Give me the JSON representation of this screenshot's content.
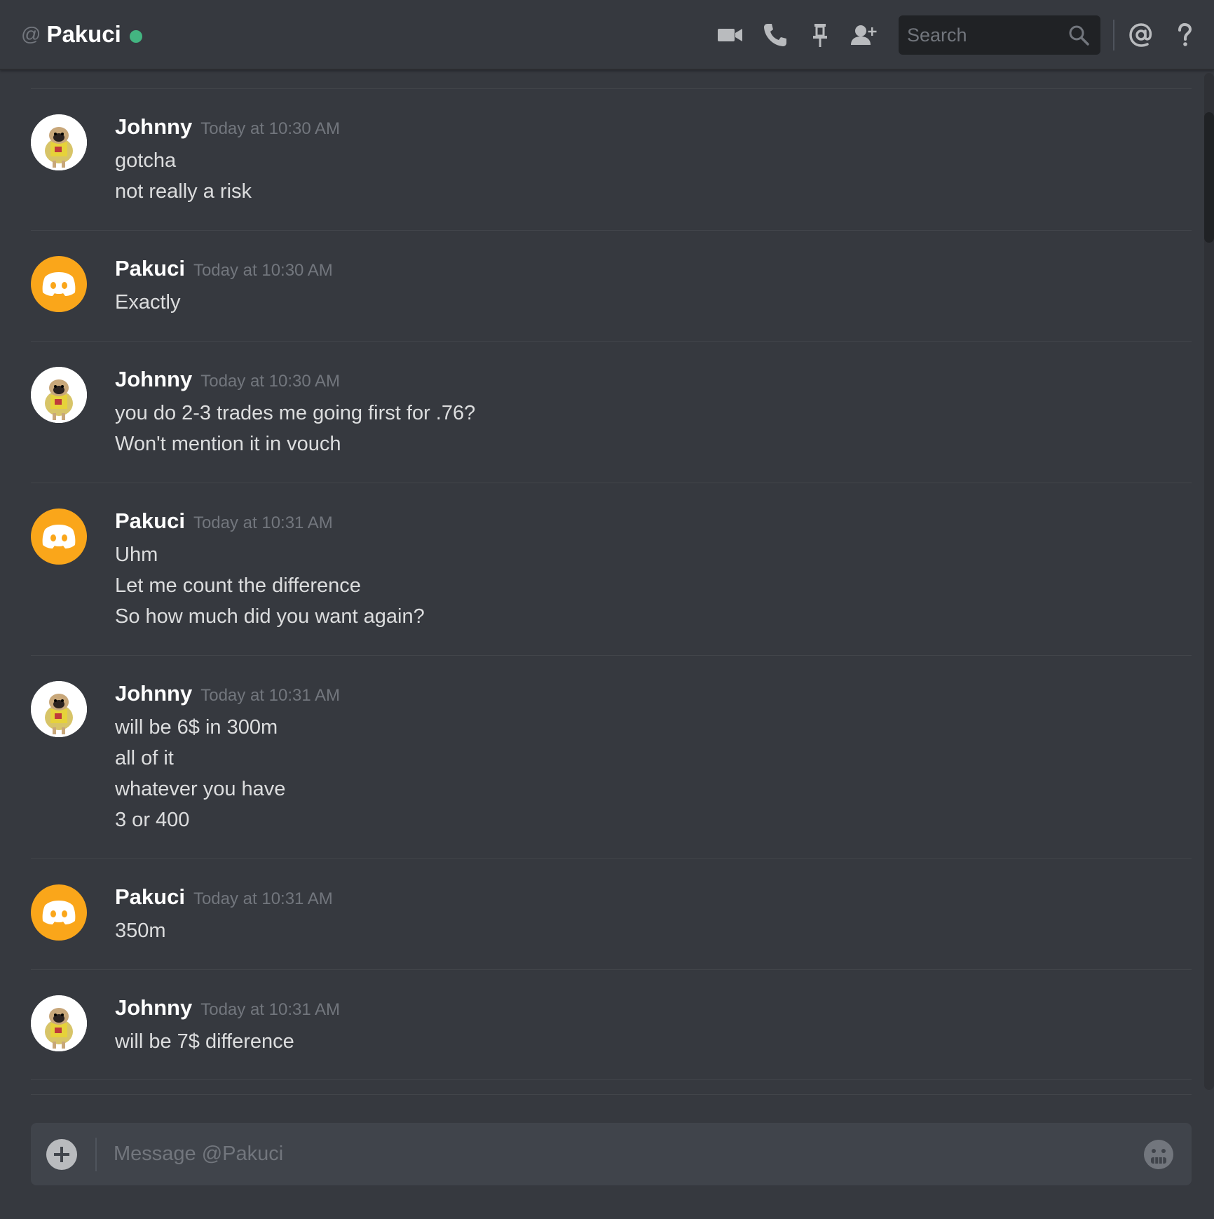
{
  "header": {
    "at_symbol": "@",
    "channel_name": "Pakuci",
    "status": "online",
    "status_color": "#43b581",
    "icons": [
      "video-icon",
      "phone-icon",
      "pin-icon",
      "add-friend-icon"
    ],
    "search_placeholder": "Search",
    "right_icons": [
      "mention-icon",
      "help-icon"
    ]
  },
  "messages": [
    {
      "author": "Johnny",
      "timestamp": "Today at 10:30 AM",
      "avatar": "pug-avatar",
      "lines": [
        "gotcha",
        "not really a risk"
      ]
    },
    {
      "author": "Pakuci",
      "timestamp": "Today at 10:30 AM",
      "avatar": "discord-default-avatar",
      "lines": [
        "Exactly"
      ]
    },
    {
      "author": "Johnny",
      "timestamp": "Today at 10:30 AM",
      "avatar": "pug-avatar",
      "lines": [
        "you do 2-3 trades me going first for .76?",
        "Won't mention it in vouch"
      ]
    },
    {
      "author": "Pakuci",
      "timestamp": "Today at 10:31 AM",
      "avatar": "discord-default-avatar",
      "lines": [
        "Uhm",
        "Let me count the difference",
        "So how much did you want again?"
      ]
    },
    {
      "author": "Johnny",
      "timestamp": "Today at 10:31 AM",
      "avatar": "pug-avatar",
      "lines": [
        "will be 6$ in 300m",
        "all of it",
        "whatever you have",
        "3 or 400"
      ]
    },
    {
      "author": "Pakuci",
      "timestamp": "Today at 10:31 AM",
      "avatar": "discord-default-avatar",
      "lines": [
        "350m"
      ]
    },
    {
      "author": "Johnny",
      "timestamp": "Today at 10:31 AM",
      "avatar": "pug-avatar",
      "lines": [
        "will be 7$ difference"
      ]
    }
  ],
  "composer": {
    "placeholder": "Message @Pakuci",
    "left_icon": "add-attachment-icon",
    "right_icon": "emoji-icon"
  },
  "colors": {
    "background": "#36393f",
    "header_bg": "#36393f",
    "composer_bg": "#40444b",
    "accent_orange": "#faa61a",
    "online_green": "#43b581",
    "muted_text": "#72767d",
    "body_text": "#dcddde"
  }
}
